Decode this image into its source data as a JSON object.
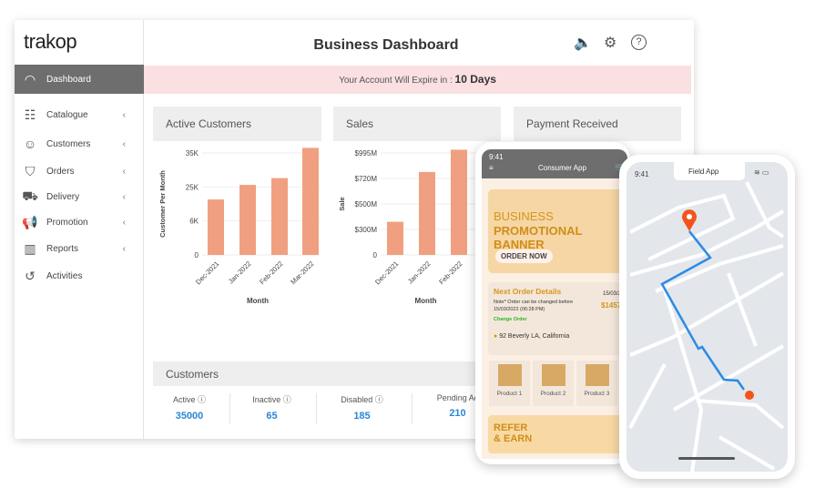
{
  "brand": "trakop",
  "sidebar": {
    "items": [
      {
        "label": "Dashboard",
        "icon": "speedometer-icon",
        "active": true
      },
      {
        "label": "Catalogue",
        "icon": "catalogue-icon"
      },
      {
        "label": "Customers",
        "icon": "user-icon"
      },
      {
        "label": "Orders",
        "icon": "orders-bag-icon"
      },
      {
        "label": "Delivery",
        "icon": "truck-icon"
      },
      {
        "label": "Promotion",
        "icon": "megaphone-icon"
      },
      {
        "label": "Reports",
        "icon": "chart-icon"
      },
      {
        "label": "Activities",
        "icon": "history-icon"
      }
    ]
  },
  "header": {
    "title": "Business Dashboard",
    "icons": [
      "speaker-icon",
      "gear-icon",
      "help-icon"
    ]
  },
  "banner": {
    "text": "Your Account Will Expire in :",
    "days": "10 Days"
  },
  "cards": {
    "active_customers": "Active Customers",
    "sales": "Sales",
    "payment": "Payment Received"
  },
  "customers": {
    "title": "Customers",
    "stats": [
      {
        "label": "Active",
        "value": "35000"
      },
      {
        "label": "Inactive",
        "value": "65"
      },
      {
        "label": "Disabled",
        "value": "185"
      },
      {
        "label": "Pending Ac",
        "value": "210"
      }
    ]
  },
  "chart_data": [
    {
      "type": "bar",
      "categories": [
        "Dec-2021",
        "Jan-2022",
        "Feb-2022",
        "Mar-2022"
      ],
      "values": [
        18000,
        25600,
        27600,
        36500
      ],
      "xlabel": "Month",
      "ylabel": "Customer Per Month",
      "yticks": [
        {
          "v": 0,
          "label": "0"
        },
        {
          "v": 6000,
          "label": "6K"
        },
        {
          "v": 25000,
          "label": "25K"
        },
        {
          "v": 35000,
          "label": "35K"
        }
      ],
      "color": "#f0a080",
      "grid": true
    },
    {
      "type": "bar",
      "categories": [
        "Dec-2021",
        "Jan-2022",
        "Feb-2022",
        "Mar-"
      ],
      "values": [
        360,
        790,
        1030,
        null
      ],
      "xlabel": "Month",
      "ylabel": "Sale",
      "yticks": [
        {
          "v": 0,
          "label": "0"
        },
        {
          "v": 300,
          "label": "$300M"
        },
        {
          "v": 500,
          "label": "$500M"
        },
        {
          "v": 720,
          "label": "$720M"
        },
        {
          "v": 995,
          "label": "$995M"
        }
      ],
      "color": "#f0a080",
      "grid": true
    }
  ],
  "consumer_app": {
    "time": "9:41",
    "title": "Consumer App",
    "banner_line1": "BUSINESS",
    "banner_line2": "PROMOTIONAL BANNER",
    "order_now": "ORDER NOW",
    "next_order": "Next Order Details",
    "note": "Note* Order can be changed before 15/03/2022 (06:28 PM)",
    "change_order": "Change Order",
    "date": "15/03/2",
    "amount": "$1457",
    "address": "92 Beverly LA, California",
    "products": [
      "Product 1",
      "Product 2",
      "Product 3"
    ],
    "refer1": "REFER",
    "refer2": "& EARN"
  },
  "field_app": {
    "time": "9:41",
    "title": "Field App",
    "route_color": "#2b8be6",
    "pin_color": "#f2541b"
  }
}
